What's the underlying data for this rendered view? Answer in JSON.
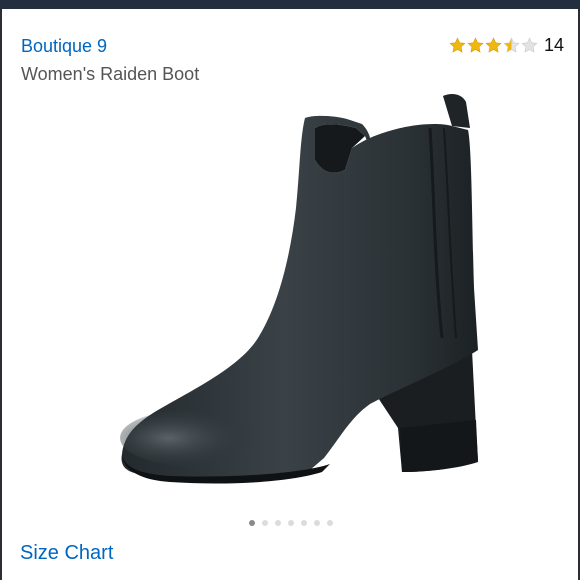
{
  "header": {
    "bar_color": "#232f3e"
  },
  "product": {
    "brand": "Boutique 9",
    "title": "Women's Raiden Boot",
    "rating": {
      "stars": 3.5,
      "max": 5,
      "count": "14",
      "star_color": "#f0b70f"
    },
    "image": {
      "icon": "ankle-boot-image",
      "color": "#2e3438"
    },
    "carousel": {
      "total": 7,
      "active_index": 0
    }
  },
  "links": {
    "size_chart": "Size Chart"
  },
  "colors": {
    "link": "#0066c0",
    "text": "#555555"
  }
}
